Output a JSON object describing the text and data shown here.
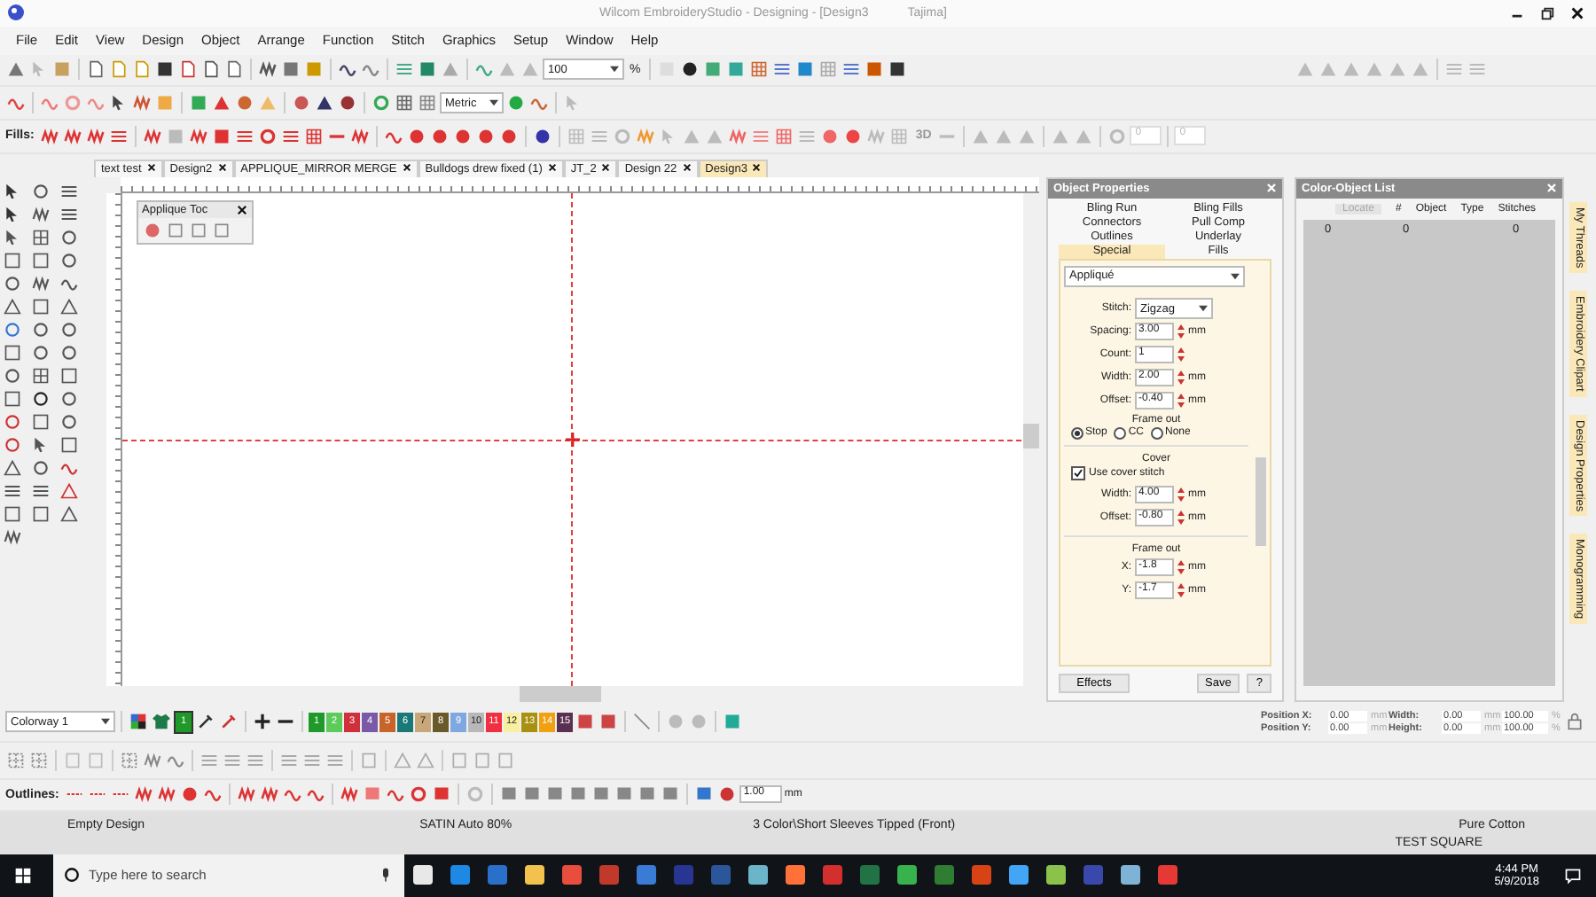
{
  "window": {
    "title": "Wilcom EmbroideryStudio - Designing - [Design3",
    "title_suffix": "Tajima]"
  },
  "menu": [
    "File",
    "Edit",
    "View",
    "Design",
    "Object",
    "Arrange",
    "Function",
    "Stitch",
    "Graphics",
    "Setup",
    "Window",
    "Help"
  ],
  "toolbar": {
    "zoom": "100",
    "zoom_unit": "%",
    "units": "Metric",
    "fills_label": "Fills:",
    "button_3d": "3D",
    "rotation": "0",
    "slant": "0"
  },
  "doc_tabs": [
    {
      "label": "text test",
      "selected": false
    },
    {
      "label": "Design2",
      "selected": false
    },
    {
      "label": "APPLIQUE_MIRROR MERGE",
      "selected": false
    },
    {
      "label": "Bulldogs drew fixed (1)",
      "selected": false
    },
    {
      "label": "JT_2",
      "selected": false
    },
    {
      "label": "Design 22",
      "selected": false
    },
    {
      "label": "Design3",
      "selected": true
    }
  ],
  "applique_toolbar": {
    "title": "Applique Toc"
  },
  "object_properties": {
    "title": "Object Properties",
    "tabs": [
      {
        "label": "Bling Run",
        "selected": false
      },
      {
        "label": "Bling Fills",
        "selected": false
      },
      {
        "label": "Connectors",
        "selected": false
      },
      {
        "label": "Pull Comp",
        "selected": false
      },
      {
        "label": "Outlines",
        "selected": false
      },
      {
        "label": "Underlay",
        "selected": false
      },
      {
        "label": "Special",
        "selected": true
      },
      {
        "label": "Fills",
        "selected": false
      }
    ],
    "type": "Appliqué",
    "stitch": {
      "label": "Stitch:",
      "value": "Zigzag"
    },
    "fields": [
      {
        "label": "Spacing:",
        "value": "3.00",
        "unit": "mm"
      },
      {
        "label": "Count:",
        "value": "1"
      },
      {
        "label": "Width:",
        "value": "2.00",
        "unit": "mm"
      },
      {
        "label": "Offset:",
        "value": "-0.40",
        "unit": "mm"
      }
    ],
    "frame_out": {
      "heading": "Frame out",
      "options": [
        {
          "label": "Stop",
          "selected": true
        },
        {
          "label": "CC",
          "selected": false
        },
        {
          "label": "None",
          "selected": false
        }
      ]
    },
    "cover": {
      "heading": "Cover",
      "checkbox": {
        "label": "Use cover stitch",
        "checked": true
      },
      "fields": [
        {
          "label": "Width:",
          "value": "4.00",
          "unit": "mm"
        },
        {
          "label": "Offset:",
          "value": "-0.80",
          "unit": "mm"
        }
      ]
    },
    "frame_out_offset": {
      "heading": "Frame out",
      "fields": [
        {
          "label": "X:",
          "value": "-1.8",
          "unit": "mm"
        },
        {
          "label": "Y:",
          "value": "-1.7",
          "unit": "mm"
        }
      ]
    },
    "buttons": [
      "Effects",
      "Save",
      "?"
    ]
  },
  "color_object_list": {
    "title": "Color-Object List",
    "locate": "Locate",
    "columns": [
      "#",
      "Object",
      "Type",
      "Stitches"
    ],
    "row": {
      "column_1": "0",
      "number": "0",
      "stitches": "0"
    }
  },
  "side_tabs": [
    "My Threads",
    "Embroidery Clipart",
    "Design Properties",
    "Monogramming"
  ],
  "colorway": {
    "name": "Colorway 1",
    "current": "1",
    "swatches": [
      {
        "label": "1",
        "color": "#1f9a2a"
      },
      {
        "label": "2",
        "color": "#5ccb5a"
      },
      {
        "label": "3",
        "color": "#d0303c"
      },
      {
        "label": "4",
        "color": "#7a5aa8"
      },
      {
        "label": "5",
        "color": "#c8642a"
      },
      {
        "label": "6",
        "color": "#1a7878"
      },
      {
        "label": "7",
        "color": "#c8a878"
      },
      {
        "label": "8",
        "color": "#6a5a2a"
      },
      {
        "label": "9",
        "color": "#80a8e0"
      },
      {
        "label": "10",
        "color": "#b8b8b8"
      },
      {
        "label": "11",
        "color": "#f03040"
      },
      {
        "label": "12",
        "color": "#f8f0a0"
      },
      {
        "label": "13",
        "color": "#a89010"
      },
      {
        "label": "14",
        "color": "#f0a010"
      },
      {
        "label": "15",
        "color": "#5a3050"
      }
    ]
  },
  "position": [
    [
      {
        "label": "Position X:",
        "value": "0.00",
        "unit": "mm"
      },
      {
        "label": "Width:",
        "value": "0.00",
        "unit": "mm",
        "percent": "100.00",
        "percent_unit": "%"
      }
    ],
    [
      {
        "label": "Position Y:",
        "value": "0.00",
        "unit": "mm"
      },
      {
        "label": "Height:",
        "value": "0.00",
        "unit": "mm",
        "percent": "100.00",
        "percent_unit": "%"
      }
    ]
  ],
  "outlines": {
    "label": "Outlines:",
    "thickness": "1.00",
    "unit": "mm"
  },
  "status_bar": {
    "design": "Empty Design",
    "stitch": "SATIN Auto 80%",
    "product": "3 Color\\Short Sleeves Tipped (Front)",
    "fabric": "Pure Cotton",
    "design_name": "TEST SQUARE"
  },
  "taskbar": {
    "search_placeholder": "Type here to search",
    "time": "4:44 PM",
    "date": "5/9/2018"
  }
}
